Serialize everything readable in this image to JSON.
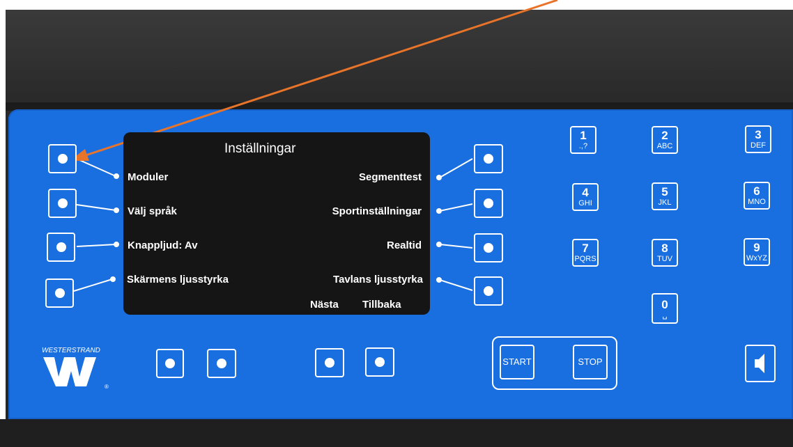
{
  "screen": {
    "title": "Inställningar",
    "left_items": [
      "Moduler",
      "Välj språk",
      "Knappljud: Av",
      "Skärmens ljusstyrka"
    ],
    "right_items": [
      "Segmenttest",
      "Sportinställningar",
      "Realtid",
      "Tavlans ljusstyrka"
    ],
    "bottom_items": [
      "Nästa",
      "Tillbaka"
    ]
  },
  "keypad": [
    {
      "num": "1",
      "sub": ".,?"
    },
    {
      "num": "2",
      "sub": "ABC"
    },
    {
      "num": "3",
      "sub": "DEF"
    },
    {
      "num": "4",
      "sub": "GHI"
    },
    {
      "num": "5",
      "sub": "JKL"
    },
    {
      "num": "6",
      "sub": "MNO"
    },
    {
      "num": "7",
      "sub": "PQRS"
    },
    {
      "num": "8",
      "sub": "TUV"
    },
    {
      "num": "9",
      "sub": "WxYZ"
    },
    {
      "num": "0",
      "sub": "␣"
    }
  ],
  "controls": {
    "start_label": "START",
    "stop_label": "STOP"
  },
  "brand": {
    "name": "WESTERSTRAND",
    "registered": "®"
  },
  "colors": {
    "panel": "#1a6fe0",
    "annotation_arrow": "#e8742a",
    "lcd": "#151515"
  },
  "icons": [
    "speaker-icon",
    "westerstrand-logo"
  ]
}
